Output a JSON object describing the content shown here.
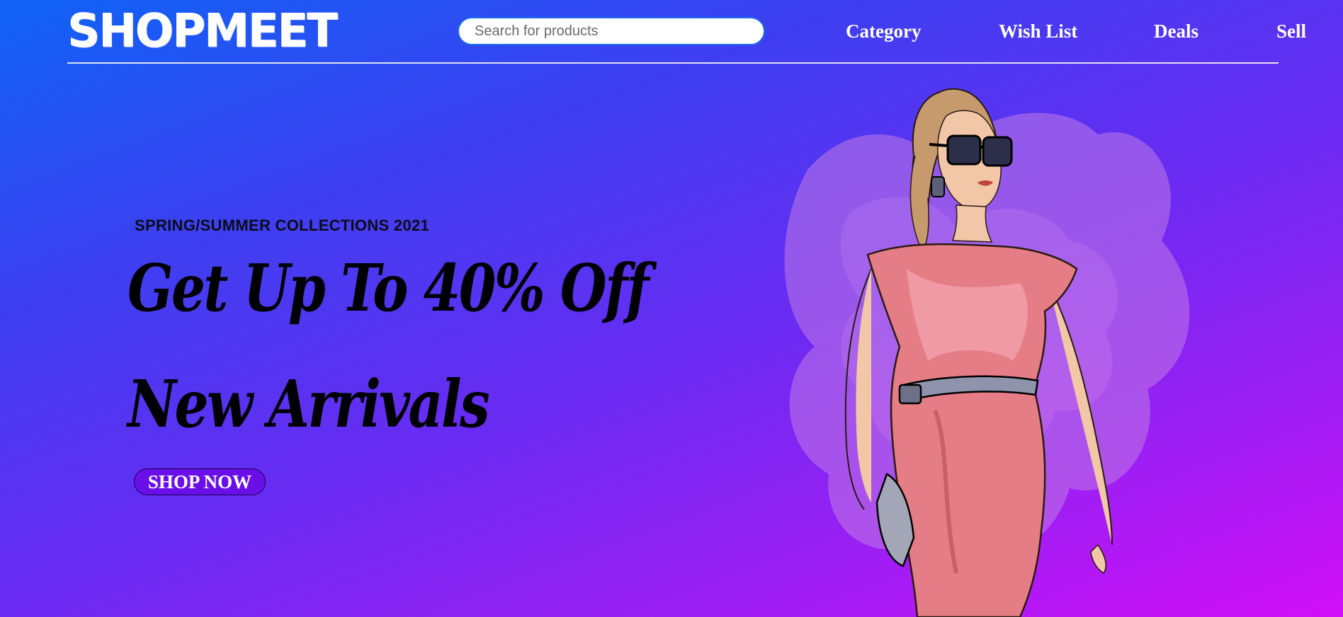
{
  "header": {
    "logo_text": "SHOPMEET",
    "search": {
      "placeholder": "Search for products",
      "value": ""
    },
    "nav": [
      {
        "label": "Category"
      },
      {
        "label": "Wish List"
      },
      {
        "label": "Deals"
      },
      {
        "label": "Sell"
      }
    ]
  },
  "hero": {
    "eyebrow": "SPRING/SUMMER COLLECTIONS 2021",
    "headline_line1": "Get Up To 40% Off",
    "headline_line2": "New Arrivals",
    "cta_label": "SHOP NOW",
    "illustration": "fashion-model-illustration"
  },
  "colors": {
    "gradient_start": "#0f63f5",
    "gradient_mid": "#6a2bf2",
    "gradient_end": "#d10ef7",
    "cta_background": "#6b0fe8",
    "text_primary": "#000000",
    "nav_text": "#ffffff"
  }
}
